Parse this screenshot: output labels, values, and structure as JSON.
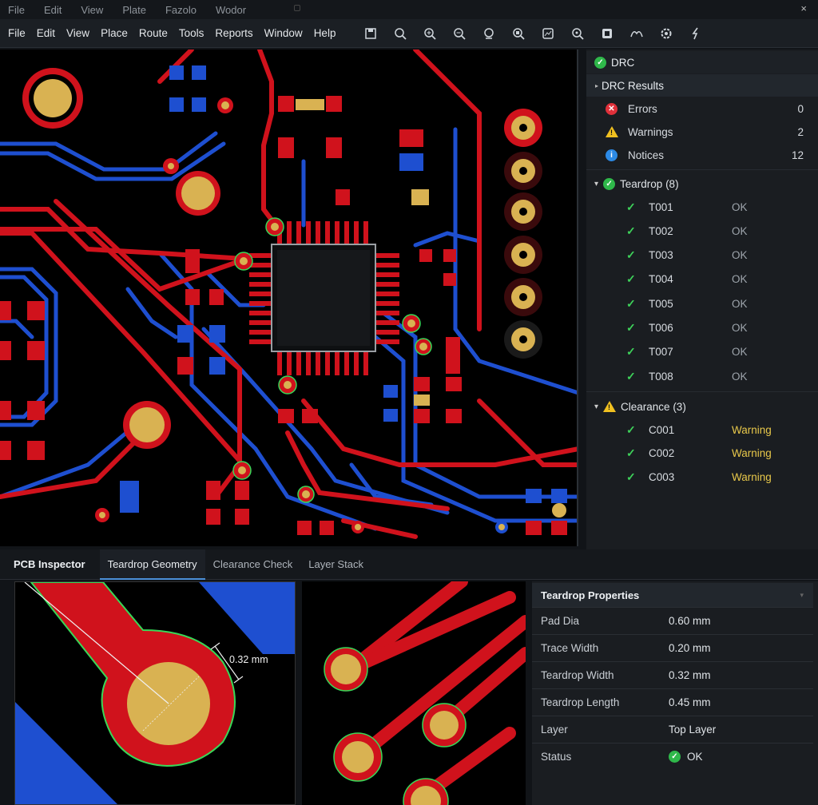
{
  "titlebar": {
    "items": [
      "File",
      "Edit",
      "View",
      "Plate",
      "Fazolo",
      "Wodor"
    ],
    "close": "×"
  },
  "menu": [
    "File",
    "Edit",
    "View",
    "Place",
    "Route",
    "Tools",
    "Reports",
    "Window",
    "Help"
  ],
  "toolbar": [
    "save-icon",
    "zoom-icon",
    "zoom-in-icon",
    "zoom-out-icon",
    "zoom-fit-icon",
    "zoom-area-icon",
    "layers-icon",
    "pan-icon",
    "3d-view-icon",
    "net-icon",
    "settings-icon",
    "route-icon"
  ],
  "drc": {
    "title": "DRC",
    "results_title": "DRC Results",
    "errors": {
      "label": "Errors",
      "count": "0"
    },
    "warnings": {
      "label": "Warnings",
      "count": "2"
    },
    "notices": {
      "label": "Notices",
      "count": "12"
    },
    "teardrop": {
      "title": "Teardrop (8)",
      "items": [
        {
          "id": "T001",
          "status": "OK"
        },
        {
          "id": "T002",
          "status": "OK"
        },
        {
          "id": "T003",
          "status": "OK"
        },
        {
          "id": "T004",
          "status": "OK"
        },
        {
          "id": "T005",
          "status": "OK"
        },
        {
          "id": "T006",
          "status": "OK"
        },
        {
          "id": "T007",
          "status": "OK"
        },
        {
          "id": "T008",
          "status": "OK"
        }
      ]
    },
    "clearance": {
      "title": "Clearance (3)",
      "items": [
        {
          "id": "C001",
          "status": "Warning"
        },
        {
          "id": "C002",
          "status": "Warning"
        },
        {
          "id": "C003",
          "status": "Warning"
        }
      ]
    }
  },
  "inspector": {
    "title": "PCB Inspector",
    "tabs": [
      "Teardrop Geometry",
      "Clearance Check",
      "Layer Stack"
    ],
    "dimension": "0.32 mm"
  },
  "properties": {
    "title": "Teardrop Properties",
    "rows": [
      {
        "key": "Pad Dia",
        "value": "0.60 mm"
      },
      {
        "key": "Trace Width",
        "value": "0.20 mm"
      },
      {
        "key": "Teardrop Width",
        "value": "0.32 mm"
      },
      {
        "key": "Teardrop Length",
        "value": "0.45 mm"
      },
      {
        "key": "Layer",
        "value": "Top Layer"
      },
      {
        "key": "Status",
        "value": "OK"
      }
    ]
  },
  "colors": {
    "copper_top": "#d0121c",
    "copper_bottom": "#1e4fd0",
    "pad": "#d9b252",
    "outline": "#38d858",
    "ok": "#2fb84a",
    "warning": "#e8c84a"
  }
}
